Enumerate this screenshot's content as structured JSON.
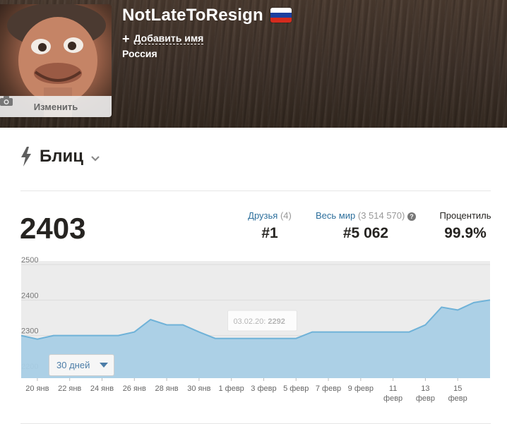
{
  "profile": {
    "username": "NotLateToResign",
    "add_name_label": "Добавить имя",
    "country": "Россия",
    "avatar_edit_label": "Изменить",
    "flag_colors": [
      "#ffffff",
      "#1c3f9f",
      "#d52b1e"
    ]
  },
  "mode": {
    "title": "Блиц",
    "icon": "lightning-bolt-icon"
  },
  "stats": {
    "rating": "2403",
    "friends": {
      "label": "Друзья",
      "count": "(4)",
      "rank": "#1"
    },
    "world": {
      "label": "Весь мир",
      "count": "(3 514 570)",
      "help": "?",
      "rank": "#5 062"
    },
    "percentile": {
      "label": "Процентиль",
      "value": "99.9%"
    }
  },
  "range_selector": {
    "label": "30 дней"
  },
  "chart_data": {
    "type": "area",
    "ylim": [
      2180,
      2510
    ],
    "y_ticks": [
      "2500",
      "2400",
      "2300",
      "2200"
    ],
    "x_labels": [
      "20 янв",
      "22 янв",
      "24 янв",
      "26 янв",
      "28 янв",
      "30 янв",
      "1 февр",
      "3 февр",
      "5 февр",
      "7 февр",
      "9 февр",
      "11 февр",
      "13 февр",
      "15 февр"
    ],
    "x_label_days": [
      1,
      3,
      5,
      7,
      9,
      11,
      13,
      15,
      17,
      19,
      21,
      23,
      25,
      27
    ],
    "days": [
      0,
      1,
      2,
      3,
      4,
      5,
      6,
      7,
      8,
      9,
      10,
      11,
      12,
      13,
      14,
      15,
      16,
      17,
      18,
      19,
      20,
      21,
      22,
      23,
      24,
      25,
      26,
      27,
      28,
      29
    ],
    "values": [
      2300,
      2290,
      2300,
      2300,
      2300,
      2300,
      2300,
      2310,
      2345,
      2330,
      2330,
      2310,
      2292,
      2292,
      2292,
      2292,
      2292,
      2292,
      2310,
      2310,
      2310,
      2310,
      2310,
      2310,
      2310,
      2330,
      2380,
      2372,
      2393,
      2400
    ],
    "tooltip": {
      "date": "03.02.20:",
      "value": "2292",
      "day": 15
    },
    "color": "#a9cfe6",
    "line_color": "#6fb2d8",
    "background": "#ececec"
  }
}
